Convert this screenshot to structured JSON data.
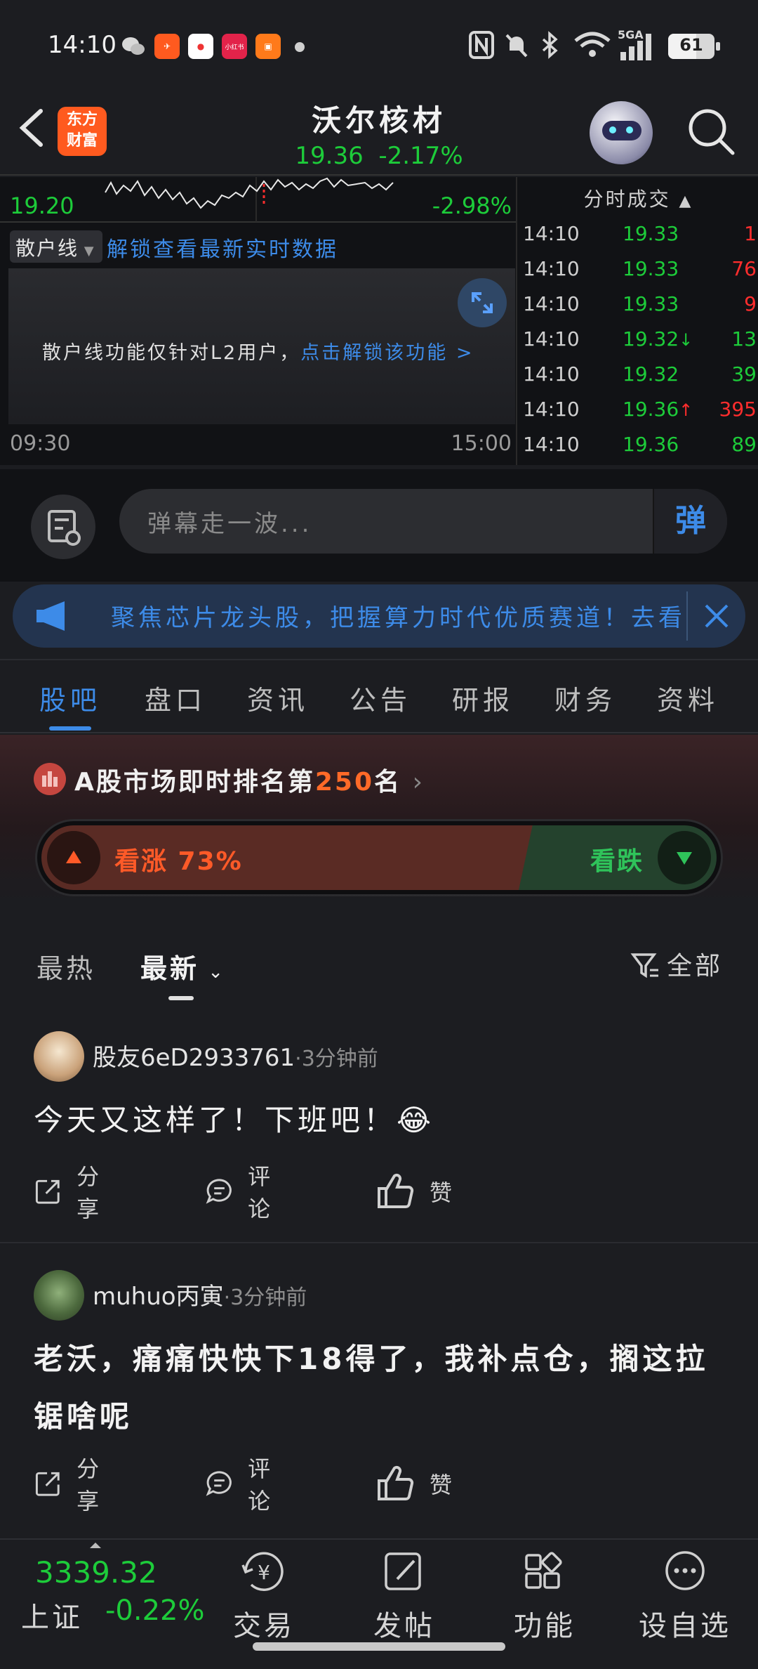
{
  "status": {
    "time": "14:10",
    "battery": "61",
    "network": "5GA"
  },
  "header": {
    "logo_line1": "东方",
    "logo_line2": "财富",
    "stock_name": "沃尔核材",
    "price": "19.36",
    "change": "-2.17%"
  },
  "chart": {
    "low_price": "19.20",
    "low_pct": "-2.98%",
    "retail_selector": "散户线",
    "unlock_link": "解锁查看最新实时数据",
    "notice_text": "散户线功能仅针对L2用户，",
    "notice_link": "点击解锁该功能 >",
    "time_start": "09:30",
    "time_end": "15:00"
  },
  "trades": {
    "header": "分时成交",
    "rows": [
      {
        "time": "14:10",
        "price": "19.33",
        "arrow": "",
        "vol": "1",
        "color": "#ff2d2d"
      },
      {
        "time": "14:10",
        "price": "19.33",
        "arrow": "",
        "vol": "76",
        "color": "#ff2d2d"
      },
      {
        "time": "14:10",
        "price": "19.33",
        "arrow": "",
        "vol": "9",
        "color": "#ff2d2d"
      },
      {
        "time": "14:10",
        "price": "19.32",
        "arrow": "↓",
        "vol": "13",
        "color": "#1dcc3a"
      },
      {
        "time": "14:10",
        "price": "19.32",
        "arrow": "",
        "vol": "39",
        "color": "#1dcc3a"
      },
      {
        "time": "14:10",
        "price": "19.36",
        "arrow": "↑",
        "vol": "395",
        "color": "#ff2d2d"
      },
      {
        "time": "14:10",
        "price": "19.36",
        "arrow": "",
        "vol": "89",
        "color": "#1dcc3a"
      }
    ]
  },
  "danmu": {
    "placeholder": "弹幕走一波...",
    "button": "弹"
  },
  "promo": {
    "text": "聚焦芯片龙头股，把握算力时代优质赛道！去看看"
  },
  "tabs": [
    "股吧",
    "盘口",
    "资讯",
    "公告",
    "研报",
    "财务",
    "资料"
  ],
  "rank": {
    "prefix": "A股市场即时排名第",
    "number": "250",
    "suffix": "名"
  },
  "vote": {
    "up_label": "看涨 73%",
    "down_label": "看跌",
    "up_ratio": 0.73
  },
  "sort": {
    "hot": "最热",
    "new": "最新",
    "filter": "全部"
  },
  "posts": [
    {
      "user": "股友6eD2933761",
      "ago": "·3分钟前",
      "text": "今天又这样了！下班吧！😂",
      "share": "分享",
      "comment": "评论",
      "like": "赞"
    },
    {
      "user": "muhuo丙寅",
      "ago": "·3分钟前",
      "text": "老沃，痛痛快快下18得了，我补点仓，搁这拉锯啥呢",
      "share": "分享",
      "comment": "评论",
      "like": "赞"
    }
  ],
  "bottom": {
    "index_value": "3339.32",
    "index_name": "上证",
    "index_change": "-0.22%",
    "items": [
      "交易",
      "发帖",
      "功能",
      "设自选"
    ]
  },
  "colors": {
    "accent": "#3d8be8",
    "up": "#ff2d2d",
    "down": "#1dcc3a"
  }
}
